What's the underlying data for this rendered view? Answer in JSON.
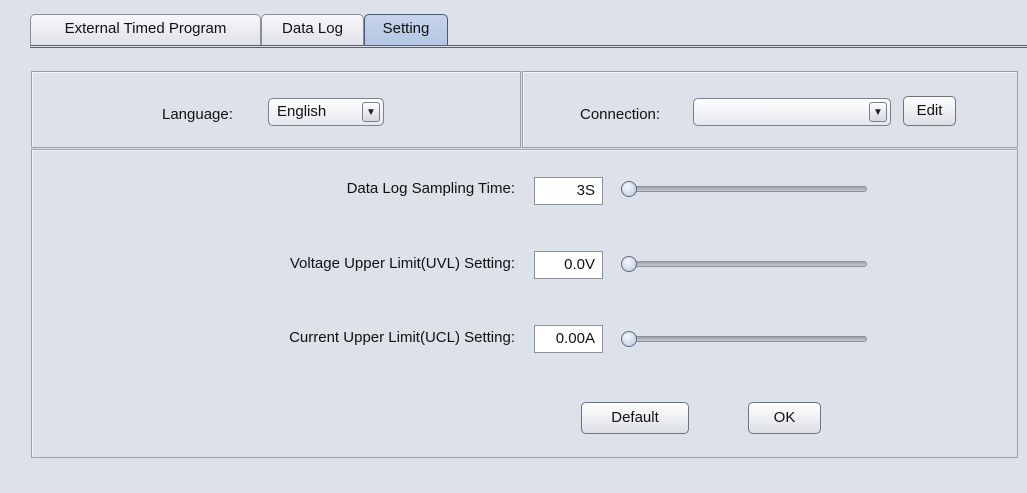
{
  "tabs": [
    {
      "label": "External Timed Program",
      "active": false
    },
    {
      "label": "Data Log",
      "active": false
    },
    {
      "label": "Setting",
      "active": true
    }
  ],
  "language": {
    "label": "Language:",
    "value": "English",
    "arrow": "▼"
  },
  "connection": {
    "label": "Connection:",
    "value": "",
    "arrow": "▼",
    "edit_label": "Edit"
  },
  "settings": [
    {
      "label": "Data Log Sampling Time:",
      "value": "3S",
      "slider_level": 0
    },
    {
      "label": "Voltage Upper Limit(UVL) Setting:",
      "value": "0.0V",
      "slider_level": 0
    },
    {
      "label": "Current Upper Limit(UCL) Setting:",
      "value": "0.00A",
      "slider_level": 0
    }
  ],
  "buttons": {
    "default_label": "Default",
    "ok_label": "OK"
  },
  "icons": {
    "dropdown": "chevron-down-icon",
    "slider": "slider-thumb-icon"
  }
}
